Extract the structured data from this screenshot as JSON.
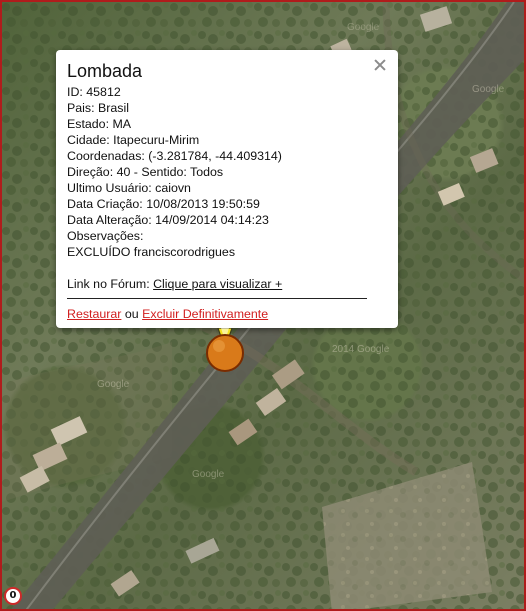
{
  "map": {
    "labels": [
      "Google",
      "Google",
      "2014 Google",
      "Google",
      "Google"
    ],
    "badge_text": "0"
  },
  "popup": {
    "title": "Lombada",
    "fields": [
      "ID: 45812",
      "Pais: Brasil",
      "Estado: MA",
      "Cidade: Itapecuru-Mirim",
      "Coordenadas: (-3.281784, -44.409314)",
      "Direção: 40 - Sentido: Todos",
      "Ultimo Usuário: caiovn",
      "Data Criação: 10/08/2013 19:50:59",
      "Data Alteração: 14/09/2014 04:14:23",
      "Observações:",
      "EXCLUÍDO franciscorodrigues"
    ],
    "forum_label": "Link no Fórum:",
    "forum_link": "Clique para visualizar +",
    "restore_link": "Restaurar",
    "or_text": "ou",
    "delete_link": "Excluir Definitivamente",
    "close_icon": "close-icon"
  },
  "colors": {
    "frame_border": "#b01c1c",
    "marker_fill": "#d97a1a",
    "marker_stroke": "#7a2c00",
    "pointer_fill": "#f4e21e",
    "action_link": "#d11f1f"
  }
}
